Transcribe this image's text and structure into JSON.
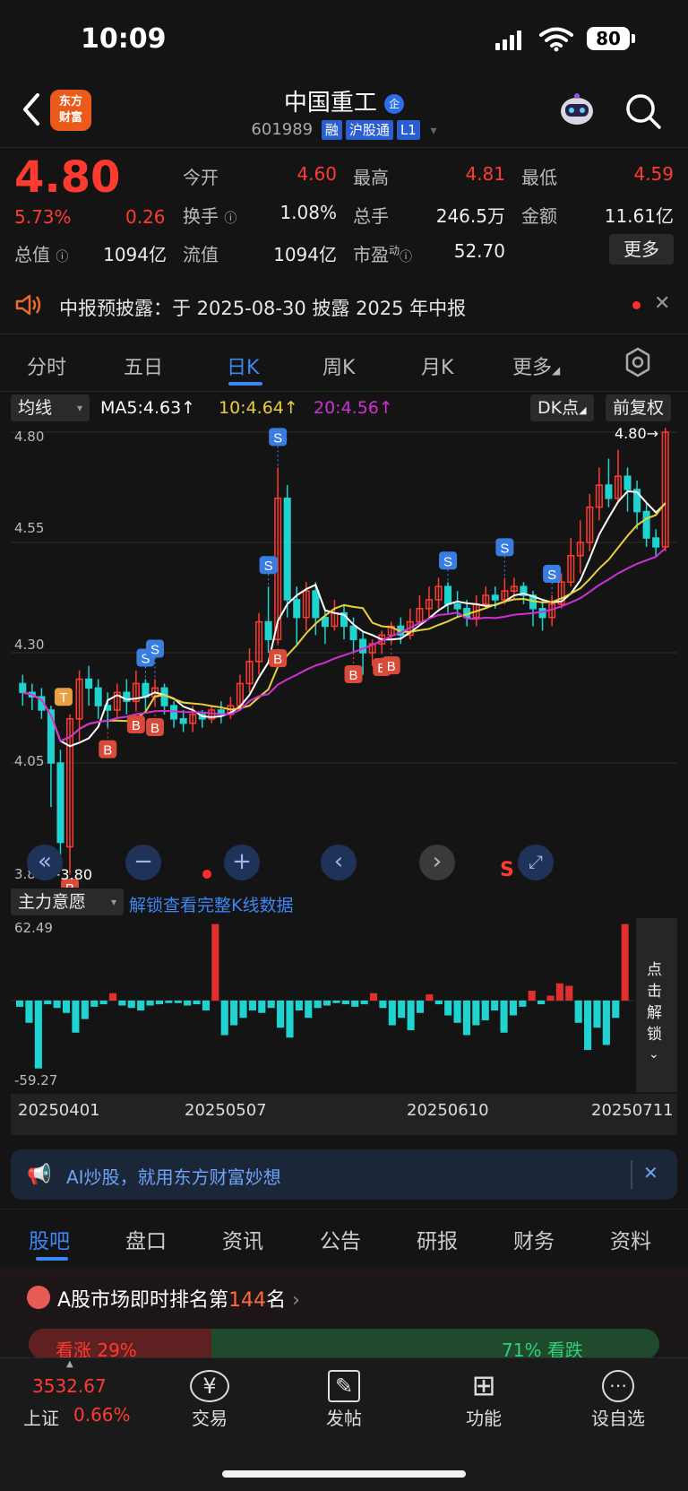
{
  "status": {
    "time": "10:09",
    "battery": "80"
  },
  "header": {
    "title": "中国重工",
    "title_badge": "企",
    "code": "601989",
    "tags": [
      "融",
      "沪股通",
      "L1"
    ],
    "logo_text": [
      "东方",
      "财富"
    ]
  },
  "quote": {
    "price": "4.80",
    "change_pct": "5.73%",
    "change": "0.26",
    "open_label": "今开",
    "open": "4.60",
    "high_label": "最高",
    "high": "4.81",
    "low_label": "最低",
    "low": "4.59",
    "turnover_label": "换手",
    "turnover": "1.08%",
    "volume_label": "总手",
    "volume": "246.5万",
    "amount_label": "金额",
    "amount": "11.61亿",
    "mktcap_label": "总值",
    "mktcap": "1094亿",
    "float_label": "流值",
    "float": "1094亿",
    "pe_label": "市盈",
    "pe_super": "动",
    "pe": "52.70",
    "more_button": "更多"
  },
  "notice": {
    "text": "中报预披露：于 2025-08-30 披露 2025 年中报"
  },
  "period_tabs": [
    "分时",
    "五日",
    "日K",
    "周K",
    "月K",
    "更多"
  ],
  "chart_toolbar": {
    "indicator": "均线",
    "ma5": "MA5:4.63↑",
    "ma10": "10:4.64↑",
    "ma20": "20:4.56↑",
    "dk": "DK点",
    "adjust": "前复权"
  },
  "colors": {
    "up": "#ff3b30",
    "down": "#1fd3d0",
    "ma5": "#ffffff",
    "ma10": "#e8d03a",
    "ma20": "#d12fd6",
    "accent": "#3d86f5"
  },
  "chart_data": {
    "type": "candlestick",
    "y_ticks": [
      "4.80",
      "4.55",
      "4.30",
      "4.05",
      "3.80"
    ],
    "ylim": [
      3.8,
      4.8
    ],
    "max_label": "4.80→",
    "min_label": "←3.80",
    "x_labels": [
      "20250401",
      "20250507",
      "20250610",
      "20250711"
    ],
    "signals_B": [
      "B",
      "B",
      "B",
      "B",
      "B",
      "B",
      "B",
      "B"
    ],
    "signals_S": [
      "S",
      "S",
      "S",
      "S",
      "S",
      "S",
      "S"
    ],
    "signal_T": "T",
    "sub_indicator": "主力意愿",
    "sub_link": "解锁查看完整K线数据",
    "sub_max": "62.49",
    "sub_min": "-59.27",
    "unlock": "点击解锁",
    "candles": [
      [
        4.23,
        4.21,
        4.25,
        4.18
      ],
      [
        4.21,
        4.2,
        4.23,
        4.17
      ],
      [
        4.2,
        4.17,
        4.22,
        4.15
      ],
      [
        4.17,
        4.05,
        4.18,
        3.95
      ],
      [
        4.05,
        3.87,
        4.08,
        3.82
      ],
      [
        3.86,
        4.15,
        4.16,
        3.8
      ],
      [
        4.15,
        4.24,
        4.26,
        4.1
      ],
      [
        4.24,
        4.22,
        4.27,
        4.18
      ],
      [
        4.22,
        4.18,
        4.24,
        4.15
      ],
      [
        4.18,
        4.17,
        4.21,
        4.13
      ],
      [
        4.17,
        4.21,
        4.23,
        4.15
      ],
      [
        4.21,
        4.19,
        4.24,
        4.16
      ],
      [
        4.19,
        4.23,
        4.26,
        4.17
      ],
      [
        4.23,
        4.2,
        4.24,
        4.17
      ],
      [
        4.2,
        4.22,
        4.24,
        4.18
      ],
      [
        4.22,
        4.18,
        4.23,
        4.16
      ],
      [
        4.18,
        4.15,
        4.19,
        4.13
      ],
      [
        4.15,
        4.14,
        4.17,
        4.12
      ],
      [
        4.14,
        4.16,
        4.18,
        4.12
      ],
      [
        4.16,
        4.15,
        4.17,
        4.13
      ],
      [
        4.15,
        4.17,
        4.18,
        4.14
      ],
      [
        4.17,
        4.16,
        4.19,
        4.14
      ],
      [
        4.16,
        4.18,
        4.2,
        4.15
      ],
      [
        4.18,
        4.23,
        4.25,
        4.17
      ],
      [
        4.23,
        4.28,
        4.31,
        4.21
      ],
      [
        4.28,
        4.37,
        4.39,
        4.25
      ],
      [
        4.37,
        4.33,
        4.45,
        4.3
      ],
      [
        4.33,
        4.65,
        4.72,
        4.32
      ],
      [
        4.65,
        4.42,
        4.68,
        4.38
      ],
      [
        4.42,
        4.38,
        4.45,
        4.32
      ],
      [
        4.38,
        4.44,
        4.46,
        4.35
      ],
      [
        4.44,
        4.38,
        4.46,
        4.34
      ],
      [
        4.38,
        4.36,
        4.4,
        4.32
      ],
      [
        4.36,
        4.39,
        4.42,
        4.35
      ],
      [
        4.39,
        4.36,
        4.41,
        4.33
      ],
      [
        4.36,
        4.33,
        4.38,
        4.3
      ],
      [
        4.33,
        4.3,
        4.35,
        4.25
      ],
      [
        4.3,
        4.32,
        4.33,
        4.27
      ],
      [
        4.32,
        4.34,
        4.35,
        4.3
      ],
      [
        4.34,
        4.36,
        4.37,
        4.32
      ],
      [
        4.36,
        4.34,
        4.38,
        4.32
      ],
      [
        4.34,
        4.37,
        4.4,
        4.33
      ],
      [
        4.37,
        4.4,
        4.43,
        4.36
      ],
      [
        4.4,
        4.42,
        4.45,
        4.38
      ],
      [
        4.42,
        4.45,
        4.47,
        4.4
      ],
      [
        4.45,
        4.41,
        4.46,
        4.39
      ],
      [
        4.41,
        4.4,
        4.44,
        4.38
      ],
      [
        4.4,
        4.38,
        4.42,
        4.36
      ],
      [
        4.38,
        4.41,
        4.43,
        4.36
      ],
      [
        4.41,
        4.43,
        4.45,
        4.4
      ],
      [
        4.43,
        4.42,
        4.45,
        4.4
      ],
      [
        4.42,
        4.44,
        4.47,
        4.41
      ],
      [
        4.44,
        4.45,
        4.47,
        4.42
      ],
      [
        4.45,
        4.43,
        4.46,
        4.41
      ],
      [
        4.43,
        4.4,
        4.44,
        4.36
      ],
      [
        4.4,
        4.38,
        4.42,
        4.35
      ],
      [
        4.38,
        4.41,
        4.43,
        4.36
      ],
      [
        4.41,
        4.46,
        4.48,
        4.4
      ],
      [
        4.46,
        4.52,
        4.56,
        4.45
      ],
      [
        4.52,
        4.55,
        4.6,
        4.48
      ],
      [
        4.55,
        4.63,
        4.66,
        4.53
      ],
      [
        4.63,
        4.68,
        4.72,
        4.6
      ],
      [
        4.68,
        4.65,
        4.74,
        4.63
      ],
      [
        4.65,
        4.7,
        4.76,
        4.64
      ],
      [
        4.7,
        4.67,
        4.72,
        4.62
      ],
      [
        4.67,
        4.62,
        4.69,
        4.58
      ],
      [
        4.62,
        4.56,
        4.64,
        4.54
      ],
      [
        4.56,
        4.54,
        4.58,
        4.52
      ],
      [
        4.54,
        4.8,
        4.81,
        4.53
      ]
    ],
    "sub_values": [
      -5,
      -18,
      -55,
      -3,
      -6,
      -10,
      -26,
      -15,
      -5,
      -3,
      6,
      -4,
      -6,
      -8,
      -4,
      -3,
      -2,
      -2,
      -4,
      -3,
      -8,
      62,
      -28,
      -20,
      -14,
      -8,
      -10,
      -6,
      -22,
      -30,
      -8,
      -14,
      -6,
      -4,
      -2,
      -3,
      -5,
      -3,
      6,
      -6,
      -20,
      -14,
      -24,
      -10,
      5,
      -3,
      -12,
      -18,
      -28,
      -20,
      -16,
      -8,
      -26,
      -12,
      -5,
      8,
      -3,
      4,
      14,
      12,
      -18,
      -40,
      -22,
      -36,
      -14,
      62
    ]
  },
  "chart_controls": [
    "«",
    "−",
    "+",
    "‹",
    "›",
    "⤢"
  ],
  "chart_control_mark": "S",
  "ai_banner": {
    "text": "AI炒股，就用东方财富妙想",
    "close": "✕"
  },
  "info_tabs": [
    "股吧",
    "盘口",
    "资讯",
    "公告",
    "研报",
    "财务",
    "资料"
  ],
  "ranking": {
    "prefix": "A股市场即时排名第",
    "rank": "144",
    "suffix": "名"
  },
  "sentiment": {
    "up_label": "看涨",
    "up_pct": "29%",
    "down_label": "看跌",
    "down_pct": "71%"
  },
  "bottom_nav": {
    "index_value": "3532.67",
    "index_name": "上证",
    "index_change": "0.66%",
    "items": [
      {
        "label": "交易",
        "icon": "¥"
      },
      {
        "label": "发帖",
        "icon": "✎"
      },
      {
        "label": "功能",
        "icon": "⊞"
      },
      {
        "label": "设自选",
        "icon": "⋯"
      }
    ]
  }
}
